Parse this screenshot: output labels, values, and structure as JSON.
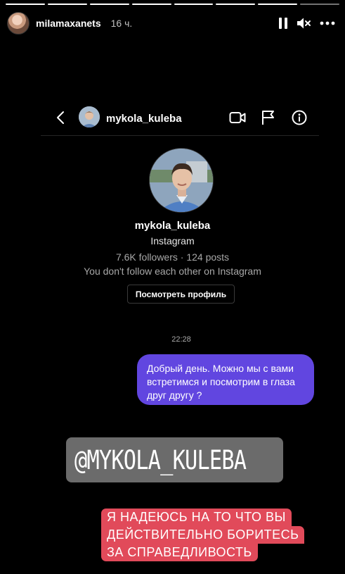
{
  "story": {
    "progress_segments": 8,
    "progress_done": 7,
    "username": "milamaxanets",
    "time_ago": "16 ч.",
    "controls": [
      "pause-icon",
      "mute-icon",
      "more-icon"
    ]
  },
  "dm": {
    "header_username": "mykola_kuleba",
    "header_icons": [
      "back-icon",
      "video-call-icon",
      "flag-icon",
      "info-icon"
    ],
    "profile": {
      "username": "mykola_kuleba",
      "platform": "Instagram",
      "stats": "7.6K followers · 124 posts",
      "follow_note": "You don't follow each other on Instagram",
      "view_profile_label": "Посмотреть профиль"
    },
    "message_time": "22:28",
    "message_text": "Добрый день. Можно мы с вами встретимся и посмотрим в глаза друг другу ?"
  },
  "stickers": {
    "mention": "@MYKOLA_KULEBA",
    "caption_lines": [
      "Я НАДЕЮСЬ НА ТО ЧТО ВЫ",
      "ДЕЙСТВИТЕЛЬНО БОРИТЕСЬ",
      "ЗА СПРАВЕДЛИВОСТЬ"
    ]
  },
  "colors": {
    "background": "#000000",
    "message_bubble": "#6146e0",
    "mention_sticker": "#6b6b6b",
    "caption_highlight": "#e14a5a"
  }
}
